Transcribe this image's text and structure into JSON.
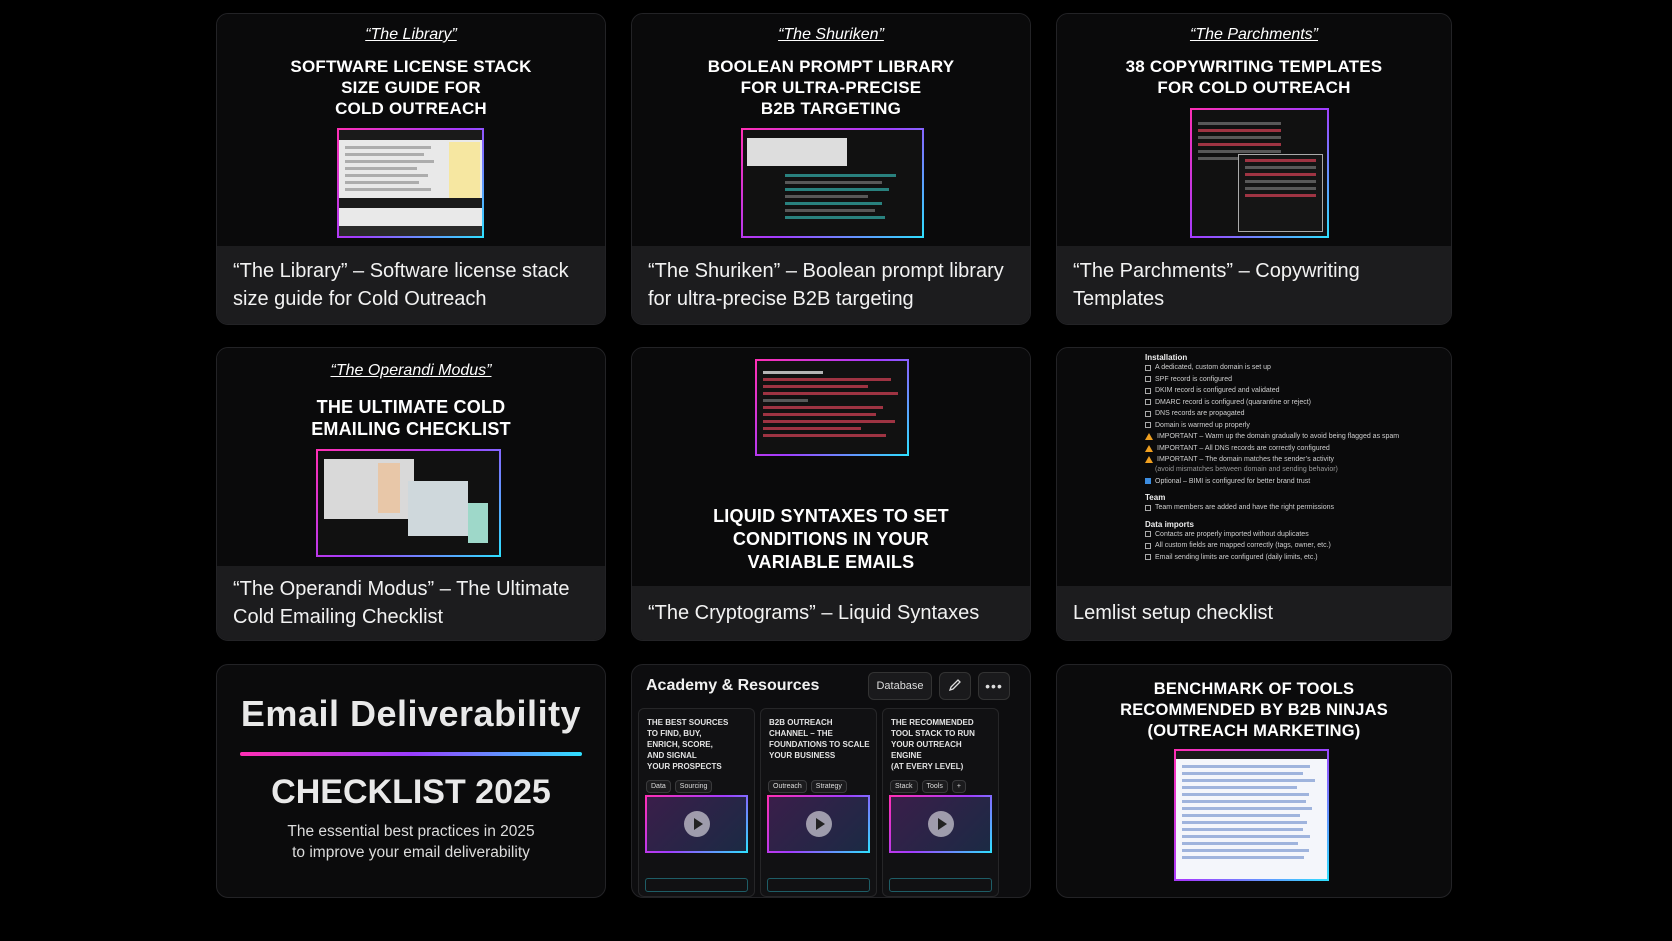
{
  "cards": {
    "library": {
      "kicker": "“The Library”",
      "headline": "SOFTWARE LICENSE STACK\nSIZE GUIDE FOR\nCOLD OUTREACH",
      "caption": "“The Library” – Software license stack size guide for Cold Outreach"
    },
    "shuriken": {
      "kicker": "“The Shuriken”",
      "headline": "BOOLEAN PROMPT LIBRARY\nFOR ULTRA-PRECISE\nB2B TARGETING",
      "caption": "“The Shuriken” – Boolean prompt library for ultra-precise B2B targeting"
    },
    "parchments": {
      "kicker": "“The Parchments”",
      "headline": "38 COPYWRITING TEMPLATES\nFOR COLD OUTREACH",
      "caption": "“The Parchments” – Copywriting Templates"
    },
    "operandi": {
      "kicker": "“The Operandi Modus”",
      "headline": "THE ULTIMATE COLD\nEMAILING CHECKLIST",
      "caption": "“The Operandi Modus” – The Ultimate Cold Emailing Checklist"
    },
    "cryptograms": {
      "headline": "LIQUID SYNTAXES TO SET\nCONDITIONS IN YOUR\nVARIABLE EMAILS",
      "caption": "“The Cryptograms” – Liquid Syntaxes"
    },
    "lemlist": {
      "caption": "Lemlist setup checklist",
      "sections": [
        {
          "title": "Installation",
          "items": [
            {
              "text": "A dedicated, custom domain is set up",
              "kind": "box"
            },
            {
              "text": "SPF record is configured",
              "kind": "box"
            },
            {
              "text": "DKIM record is configured and validated",
              "kind": "box"
            },
            {
              "text": "DMARC record is configured (quarantine or reject)",
              "kind": "box"
            },
            {
              "text": "DNS records are propagated",
              "kind": "box"
            },
            {
              "text": "Domain is warmed up properly",
              "kind": "box"
            },
            {
              "text": "IMPORTANT – Warm up the domain gradually to avoid being flagged as spam",
              "kind": "warn"
            },
            {
              "text": "IMPORTANT – All DNS records are correctly configured",
              "kind": "warn"
            },
            {
              "text": "IMPORTANT – The domain matches the sender’s activity",
              "kind": "warn"
            },
            {
              "text": "(avoid mismatches between domain and sending behavior)",
              "kind": "sub"
            },
            {
              "text": "Optional – BIMI is configured for better brand trust",
              "kind": "blue"
            }
          ]
        },
        {
          "title": "Team",
          "items": [
            {
              "text": "Team members are added and have the right permissions",
              "kind": "box"
            }
          ]
        },
        {
          "title": "Data imports",
          "items": [
            {
              "text": "Contacts are properly imported without duplicates",
              "kind": "box"
            },
            {
              "text": "All custom fields are mapped correctly (tags, owner, etc.)",
              "kind": "box"
            },
            {
              "text": "Email sending limits are configured (daily limits, etc.)",
              "kind": "box"
            }
          ]
        }
      ]
    },
    "deliverability": {
      "title": "Email Deliverability",
      "subtitle": "CHECKLIST 2025",
      "description": "The essential best practices in 2025\nto improve your email deliverability"
    },
    "academy": {
      "title": "Academy & Resources",
      "database_label": "Database",
      "edit_icon": "pencil-icon",
      "more_icon": "more-icon",
      "columns": [
        {
          "title": "THE BEST SOURCES\nTO FIND, BUY,\nENRICH, SCORE,\nAND SIGNAL\nYOUR PROSPECTS",
          "tags": [
            "Data",
            "Sourcing"
          ]
        },
        {
          "title": "B2B OUTREACH\nCHANNEL – THE\nFOUNDATIONS TO SCALE\nYOUR BUSINESS",
          "tags": [
            "Outreach",
            "Strategy"
          ]
        },
        {
          "title": "THE RECOMMENDED\nTOOL STACK TO RUN\nYOUR OUTREACH ENGINE\n(AT EVERY LEVEL)",
          "tags": [
            "Stack",
            "Tools",
            "+"
          ]
        }
      ]
    },
    "benchmark": {
      "headline": "BENCHMARK OF TOOLS\nRECOMMENDED BY B2B NINJAS\n(OUTREACH MARKETING)"
    }
  }
}
